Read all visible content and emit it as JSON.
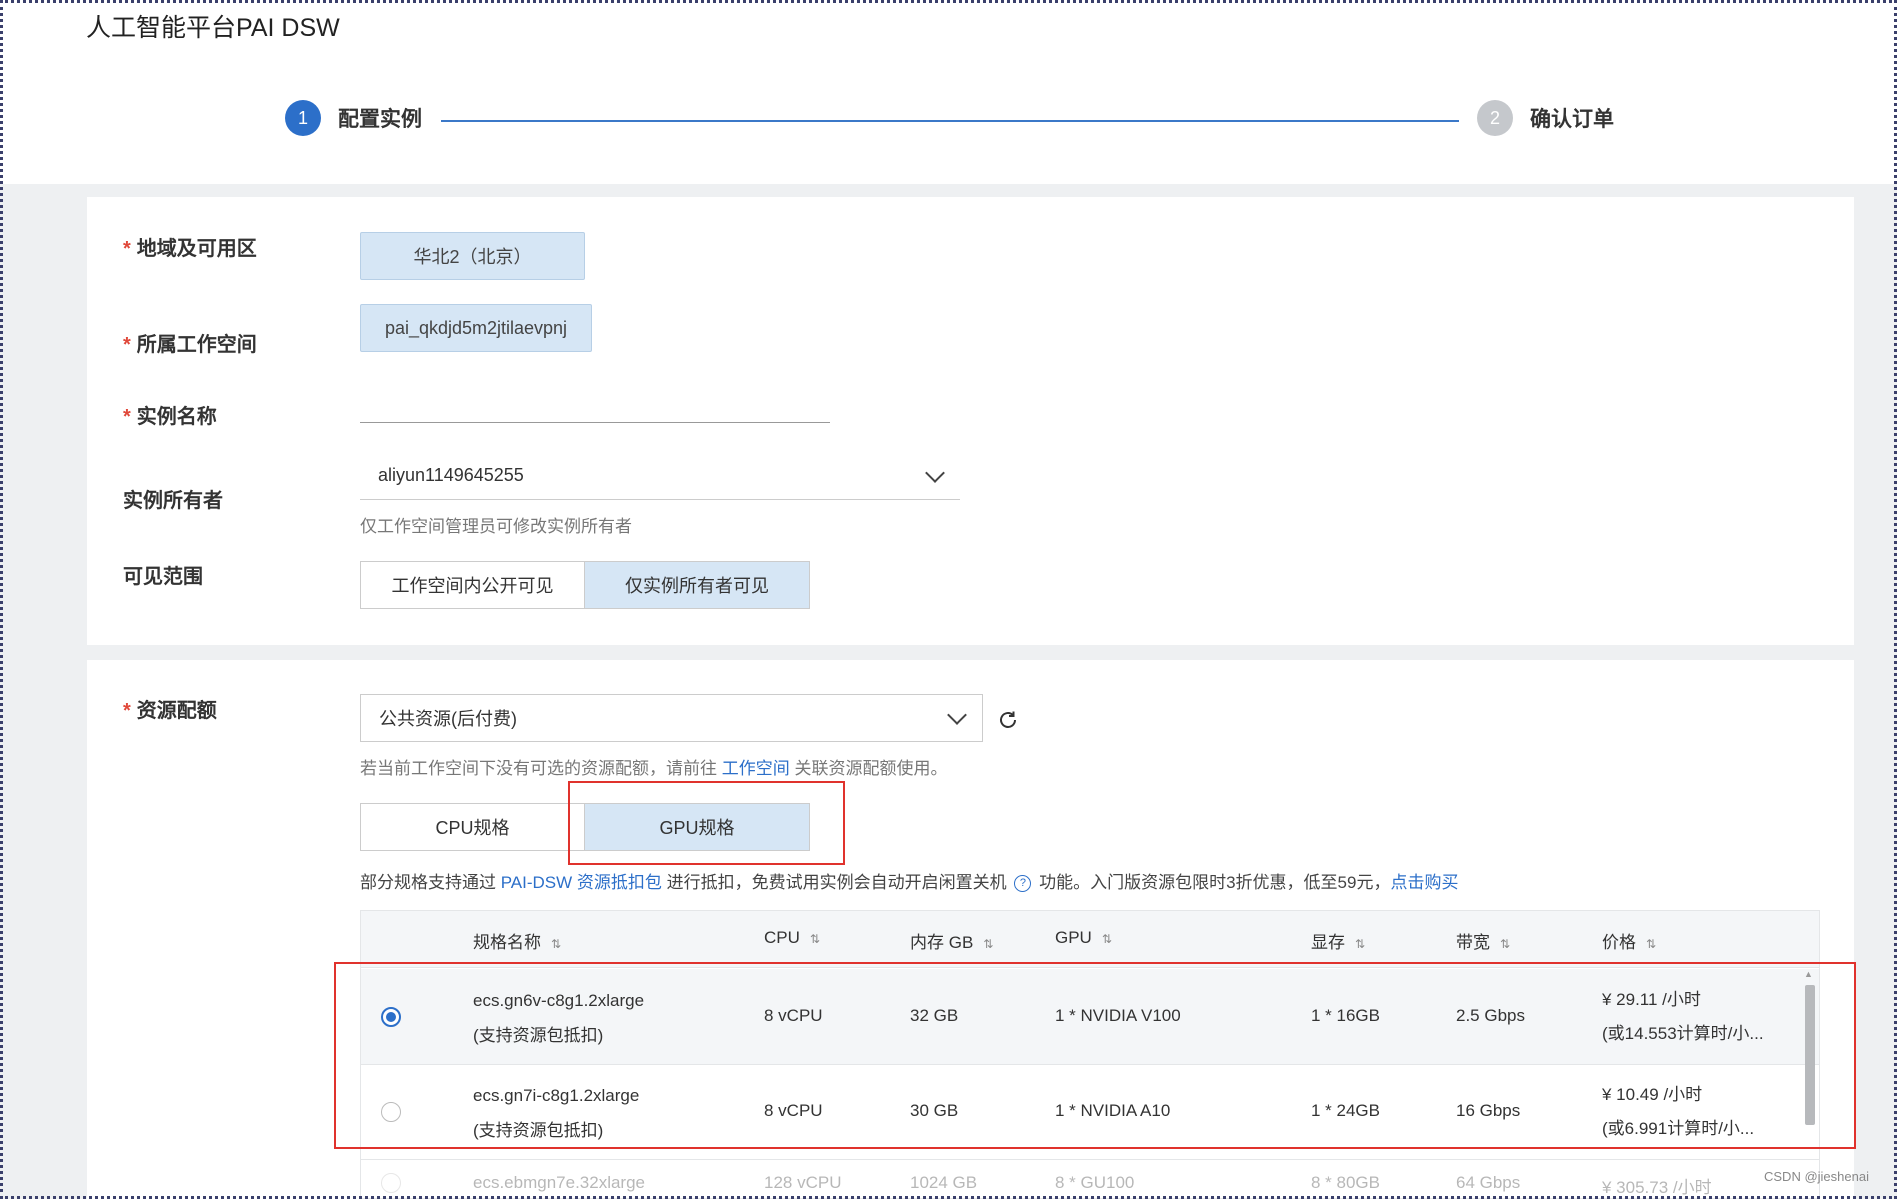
{
  "app": {
    "title": "人工智能平台PAI DSW"
  },
  "steps": [
    {
      "number": "1",
      "label": "配置实例"
    },
    {
      "number": "2",
      "label": "确认订单"
    }
  ],
  "basic": {
    "region": {
      "label": "地域及可用区",
      "value": "华北2（北京）"
    },
    "workspace": {
      "label": "所属工作空间",
      "value": "pai_qkdjd5m2jtilaevpnj"
    },
    "instance_name": {
      "label": "实例名称",
      "value": ""
    },
    "owner": {
      "label": "实例所有者",
      "value": "aliyun1149645255",
      "hint": "仅工作空间管理员可修改实例所有者"
    },
    "visibility": {
      "label": "可见范围",
      "options": [
        "工作空间内公开可见",
        "仅实例所有者可见"
      ]
    }
  },
  "resource": {
    "label": "资源配额",
    "select_value": "公共资源(后付费)",
    "hint_prefix": "若当前工作空间下没有可选的资源配额，请前往 ",
    "hint_link": "工作空间",
    "hint_suffix": " 关联资源配额使用。",
    "tabs": [
      "CPU规格",
      "GPU规格"
    ],
    "note": {
      "part1": "部分规格支持通过 ",
      "link1": "PAI-DSW 资源抵扣包",
      "part2": " 进行抵扣，免费试用实例会自动开启闲置关机 ",
      "q": "?",
      "part3": " 功能。入门版资源包限时3折优惠，低至59元，",
      "link2": "点击购买"
    },
    "table": {
      "headers": [
        "规格名称",
        "CPU",
        "内存 GB",
        "GPU",
        "显存",
        "带宽",
        "价格"
      ],
      "sort_icon": "⇅",
      "rows": [
        {
          "name": "ecs.gn6v-c8g1.2xlarge",
          "sub": "(支持资源包抵扣)",
          "cpu": "8 vCPU",
          "mem": "32 GB",
          "gpu": "1 * NVIDIA V100",
          "vram": "1 * 16GB",
          "bw": "2.5 Gbps",
          "price": "¥ 29.11 /小时",
          "price_sub": "(或14.553计算时/小...",
          "selected": true
        },
        {
          "name": "ecs.gn7i-c8g1.2xlarge",
          "sub": "(支持资源包抵扣)",
          "cpu": "8 vCPU",
          "mem": "30 GB",
          "gpu": "1 * NVIDIA A10",
          "vram": "1 * 24GB",
          "bw": "16 Gbps",
          "price": "¥ 10.49 /小时",
          "price_sub": "(或6.991计算时/小...",
          "selected": false
        },
        {
          "name": "ecs.ebmgn7e.32xlarge",
          "cpu": "128 vCPU",
          "mem": "1024 GB",
          "gpu": "8 * GU100",
          "vram": "8 * 80GB",
          "bw": "64 Gbps",
          "price": "¥ 305.73 /小时",
          "selected": false
        }
      ]
    }
  },
  "watermark": "CSDN @jieshenai"
}
